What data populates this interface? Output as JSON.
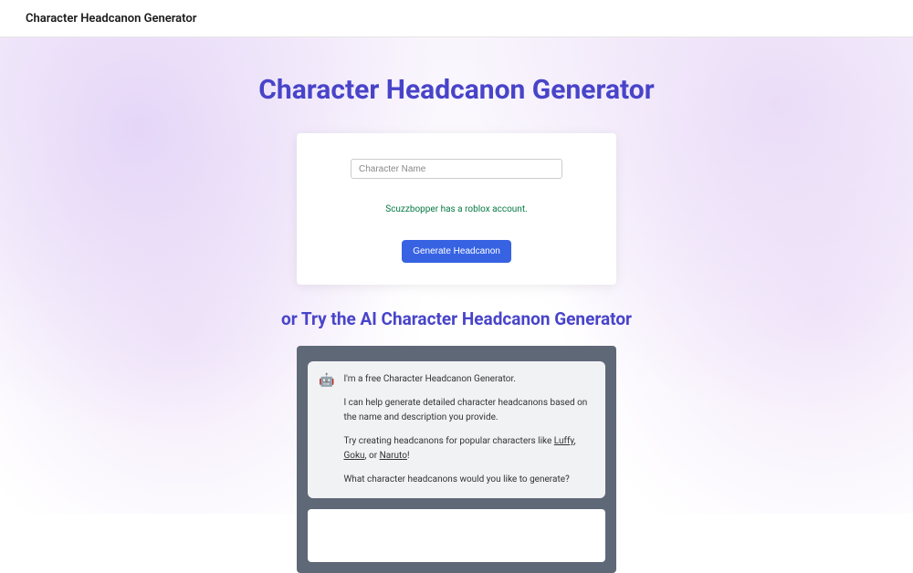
{
  "header": {
    "title": "Character Headcanon Generator"
  },
  "main": {
    "title": "Character Headcanon Generator",
    "input_placeholder": "Character Name",
    "result_text": "Scuzzbopper has a roblox account.",
    "generate_button": "Generate Headcanon",
    "subtitle": "or Try the AI Character Headcanon Generator"
  },
  "chat": {
    "intro": "I'm a free Character Headcanon Generator.",
    "desc": "I can help generate detailed character headcanons based on the name and description you provide.",
    "try_prefix": "Try creating headcanons for popular characters like ",
    "link1": "Luffy",
    "sep1": ", ",
    "link2": "Goku",
    "sep2": ", or ",
    "link3": "Naruto",
    "suffix": "!",
    "prompt": "What character headcanons would you like to generate?"
  }
}
